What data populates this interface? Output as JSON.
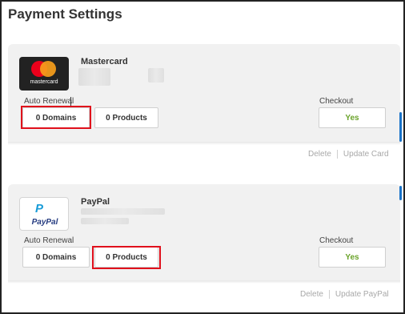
{
  "page": {
    "title": "Payment Settings"
  },
  "cards": [
    {
      "name": "Mastercard",
      "logo_caption": "mastercard",
      "auto_renewal_label": "Auto Renewal",
      "domains_label": "0 Domains",
      "products_label": "0 Products",
      "checkout_label": "Checkout",
      "checkout_value": "Yes",
      "delete_label": "Delete",
      "update_label": "Update Card"
    },
    {
      "name": "PayPal",
      "logo_caption": "PayPal",
      "logo_mark": "P",
      "auto_renewal_label": "Auto Renewal",
      "domains_label": "0 Domains",
      "products_label": "0 Products",
      "checkout_label": "Checkout",
      "checkout_value": "Yes",
      "delete_label": "Delete",
      "update_label": "Update PayPal"
    }
  ],
  "colors": {
    "accent_red": "#e0101c",
    "yes_green": "#6aa32a",
    "card_bg": "#f1f1f1",
    "scroll_accent": "#1a73c9",
    "mastercard_red": "#eb001b",
    "mastercard_yellow": "#f79e1b",
    "paypal_dark": "#253b80",
    "paypal_light": "#179bd7"
  }
}
